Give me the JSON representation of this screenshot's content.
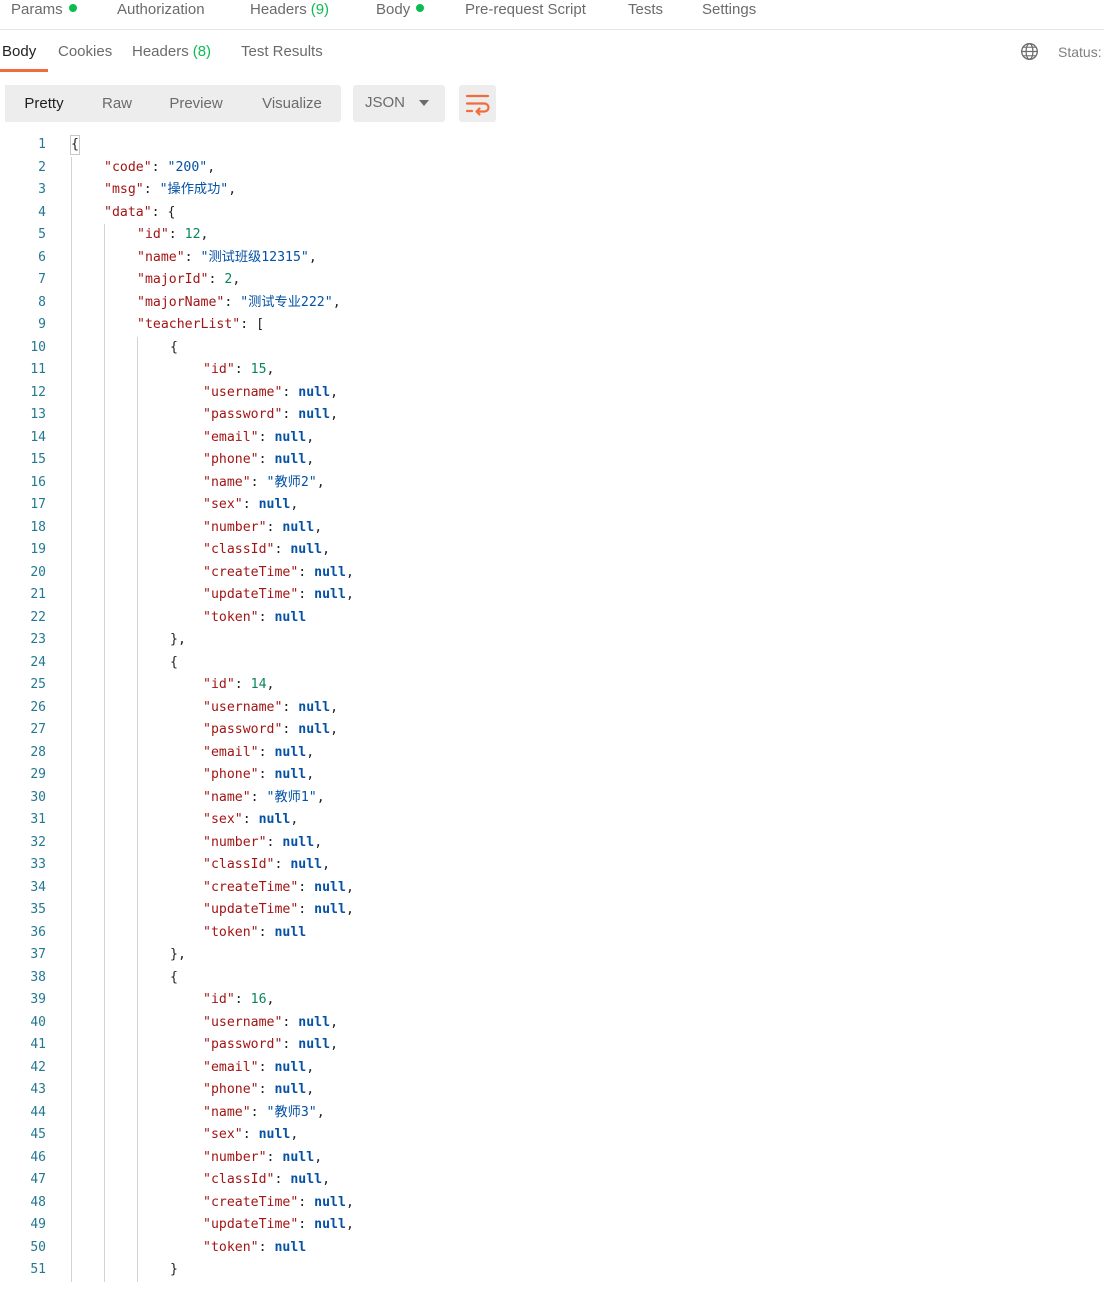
{
  "request_tabs": [
    {
      "label": "Params",
      "dot": true,
      "count": ""
    },
    {
      "label": "Authorization",
      "dot": false,
      "count": ""
    },
    {
      "label": "Headers",
      "dot": false,
      "count": "(9)"
    },
    {
      "label": "Body",
      "dot": true,
      "count": ""
    },
    {
      "label": "Pre-request Script",
      "dot": false,
      "count": ""
    },
    {
      "label": "Tests",
      "dot": false,
      "count": ""
    },
    {
      "label": "Settings",
      "dot": false,
      "count": ""
    }
  ],
  "response_tabs": [
    {
      "label": "Body",
      "count": "",
      "active": true
    },
    {
      "label": "Cookies",
      "count": "",
      "active": false
    },
    {
      "label": "Headers",
      "count": "(8)",
      "active": false
    },
    {
      "label": "Test Results",
      "count": "",
      "active": false
    }
  ],
  "status_label": "Status:",
  "view_modes": [
    "Pretty",
    "Raw",
    "Preview",
    "Visualize"
  ],
  "active_mode": "Pretty",
  "language": "JSON",
  "colors": {
    "accent": "#f26b3a",
    "success": "#0cbb52",
    "json_key": "#a31515",
    "json_string": "#0451a5",
    "json_number": "#098658",
    "json_null": "#0451a5",
    "line_number": "#237893"
  },
  "response_json": {
    "code": "200",
    "msg": "操作成功",
    "data": {
      "id": 12,
      "name": "测试班级12315",
      "majorId": 2,
      "majorName": "测试专业222",
      "teacherList": [
        {
          "id": 15,
          "username": null,
          "password": null,
          "email": null,
          "phone": null,
          "name": "教师2",
          "sex": null,
          "number": null,
          "classId": null,
          "createTime": null,
          "updateTime": null,
          "token": null
        },
        {
          "id": 14,
          "username": null,
          "password": null,
          "email": null,
          "phone": null,
          "name": "教师1",
          "sex": null,
          "number": null,
          "classId": null,
          "createTime": null,
          "updateTime": null,
          "token": null
        },
        {
          "id": 16,
          "username": null,
          "password": null,
          "email": null,
          "phone": null,
          "name": "教师3",
          "sex": null,
          "number": null,
          "classId": null,
          "createTime": null,
          "updateTime": null,
          "token": null
        }
      ]
    }
  },
  "visible_line_count": 51
}
